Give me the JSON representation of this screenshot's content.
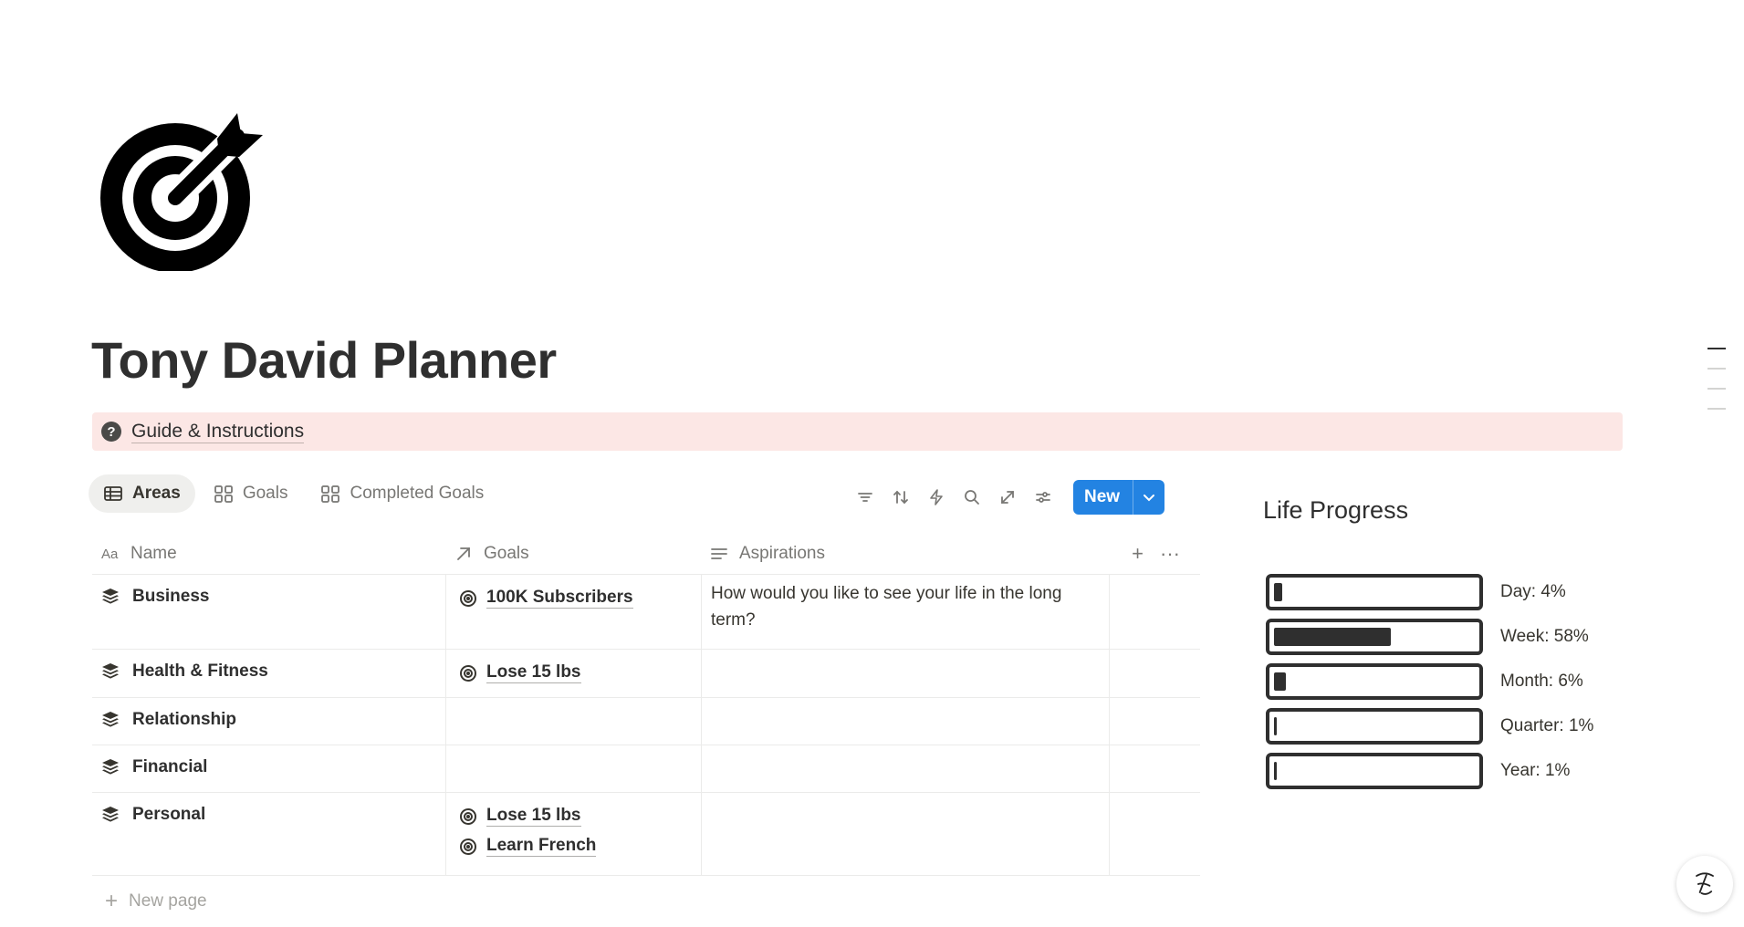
{
  "page": {
    "title": "Tony David Planner",
    "icon": "target-icon"
  },
  "callout": {
    "icon": "question-circle-icon",
    "label": "Guide & Instructions",
    "bg_color": "#fce7e5"
  },
  "views": [
    {
      "label": "Areas",
      "icon": "table-icon",
      "active": true
    },
    {
      "label": "Goals",
      "icon": "gallery-icon",
      "active": false
    },
    {
      "label": "Completed Goals",
      "icon": "gallery-icon",
      "active": false
    }
  ],
  "toolbar": {
    "icons": [
      "filter-icon",
      "sort-icon",
      "automation-icon",
      "search-icon",
      "expand-icon",
      "settings-icon"
    ],
    "new_label": "New",
    "accent": "#2383e2"
  },
  "table": {
    "columns": [
      {
        "label": "Name",
        "icon": "title-icon"
      },
      {
        "label": "Goals",
        "icon": "relation-arrow-icon"
      },
      {
        "label": "Aspirations",
        "icon": "text-lines-icon"
      }
    ],
    "rows": [
      {
        "name": "Business",
        "goals": [
          "100K Subscribers"
        ],
        "aspirations": "How would you like to see your life in the long term?"
      },
      {
        "name": "Health & Fitness",
        "goals": [
          "Lose 15 lbs"
        ],
        "aspirations": ""
      },
      {
        "name": "Relationship",
        "goals": [],
        "aspirations": ""
      },
      {
        "name": "Financial",
        "goals": [],
        "aspirations": ""
      },
      {
        "name": "Personal",
        "goals": [
          "Lose 15 lbs",
          "Learn French"
        ],
        "aspirations": ""
      }
    ],
    "new_page_label": "New page"
  },
  "life_progress": {
    "title": "Life Progress",
    "items": [
      {
        "label": "Day: 4%",
        "percent": 4
      },
      {
        "label": "Week: 58%",
        "percent": 58
      },
      {
        "label": "Month: 6%",
        "percent": 6
      },
      {
        "label": "Quarter: 1%",
        "percent": 1
      },
      {
        "label": "Year: 1%",
        "percent": 1
      }
    ]
  }
}
